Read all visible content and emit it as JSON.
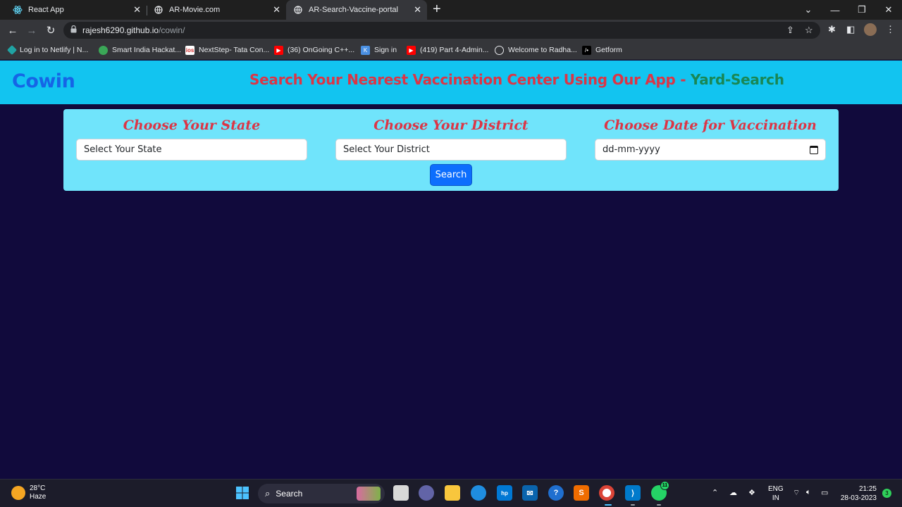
{
  "browser": {
    "tabs": [
      {
        "title": "React App",
        "icon": "react-icon"
      },
      {
        "title": "AR-Movie.com",
        "icon": "globe-icon"
      },
      {
        "title": "AR-Search-Vaccine-portal",
        "icon": "globe-icon",
        "active": true
      }
    ],
    "url_host": "rajesh6290.github.io",
    "url_path": "/cowin/",
    "bookmarks": [
      {
        "label": "Log in to Netlify | N...",
        "icon": "netlify-icon"
      },
      {
        "label": "Smart India Hackat...",
        "icon": "sih-icon"
      },
      {
        "label": "NextStep- Tata Con...",
        "icon": "tcs-icon"
      },
      {
        "label": "(36) OnGoing C++...",
        "icon": "youtube-icon"
      },
      {
        "label": "Sign in",
        "icon": "kite-icon"
      },
      {
        "label": "(419) Part 4-Admin...",
        "icon": "youtube-icon"
      },
      {
        "label": "Welcome to Radha...",
        "icon": "globe-icon"
      },
      {
        "label": "Getform",
        "icon": "getform-icon"
      }
    ]
  },
  "page": {
    "brand": "Cowin",
    "headline": "Search Your Nearest Vaccination Center Using Our App - ",
    "headline_accent": "Yard-Search",
    "state_label": "Choose Your State",
    "state_placeholder": "Select Your State",
    "district_label": "Choose Your District",
    "district_placeholder": "Select Your District",
    "date_label": "Choose Date for Vaccination",
    "date_placeholder": "dd-mm-yyyy",
    "search_button": "Search"
  },
  "taskbar": {
    "temperature": "28°C",
    "weather": "Haze",
    "search_label": "Search",
    "lang_top": "ENG",
    "lang_bottom": "IN",
    "time": "21:25",
    "date": "28-03-2023",
    "notifications": "3",
    "whatsapp_badge": "11"
  },
  "colors": {
    "header_bg": "#12c4f0",
    "card_bg": "#70e4fb",
    "page_bg": "#110a3c",
    "label_red": "#dc3545",
    "accent_green": "#198754",
    "brand_blue": "#1565e6",
    "button_blue": "#0d6efd"
  }
}
